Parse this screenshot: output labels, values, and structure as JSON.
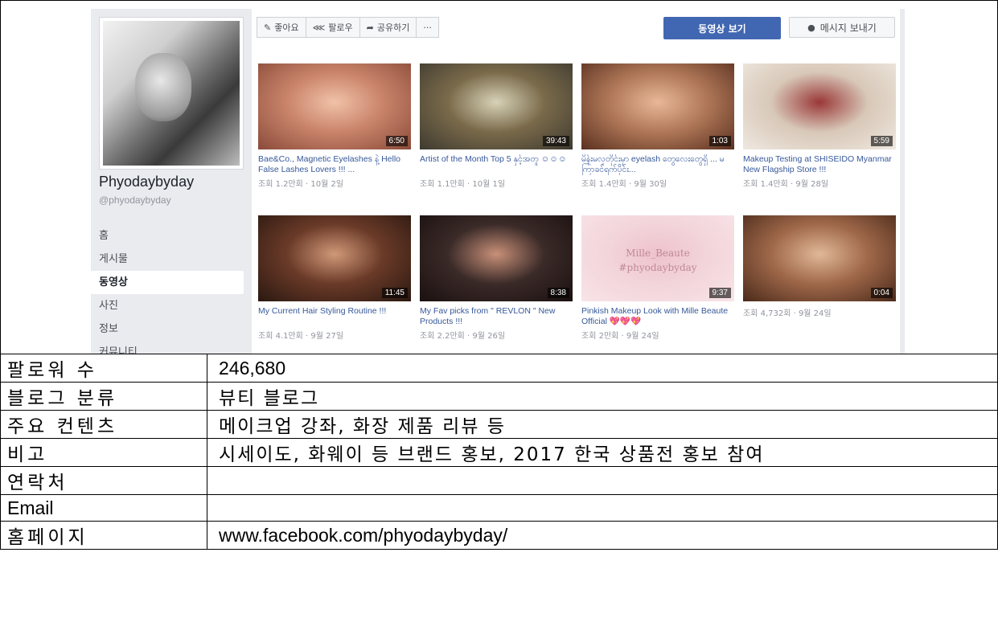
{
  "page": {
    "name": "Phyodaybyday",
    "handle": "@phyodaybyday"
  },
  "nav": [
    "홈",
    "게시물",
    "동영상",
    "사진",
    "정보",
    "커뮤니티"
  ],
  "nav_active_index": 2,
  "toolbar": {
    "like": "좋아요",
    "follow": "팔로우",
    "share": "공유하기",
    "more": "···",
    "watch": "동영상 보기",
    "message": "메시지 보내기"
  },
  "videos": [
    {
      "title": "Bae&Co., Magnetic Eyelashes နဲ့ Hello False Lashes Lovers !!! ...",
      "meta": "조회 1.2만회 · 10월 2일",
      "duration": "6:50",
      "colors": [
        "#c9836a",
        "#f0c2a8",
        "#8a4b3a"
      ]
    },
    {
      "title": "Artist of the Month Top 5 နှင့်အတူ ☺☺☺",
      "meta": "조회 1.1만회 · 10월 1일",
      "duration": "39:43",
      "colors": [
        "#7a6a4a",
        "#d8d2b8",
        "#3e3a30"
      ]
    },
    {
      "title": "မိန်းမလှတိုင်းမှာ eyelash တွေလေးတွေရှိ ... မကြာခင်ရက်ပိုင်း...",
      "meta": "조회 1.4만회 · 9월 30일",
      "duration": "1:03",
      "colors": [
        "#b07858",
        "#e8b898",
        "#5a3020"
      ]
    },
    {
      "title": "Makeup Testing at SHISEIDO Myanmar New Flagship Store !!!",
      "meta": "조회 1.4만회 · 9월 28일",
      "duration": "5:59",
      "colors": [
        "#d8c8b8",
        "#9a3838",
        "#efe8e0"
      ]
    },
    {
      "title": "My Current Hair Styling Routine !!!",
      "meta": "조회 4.1만회 · 9월 27일",
      "duration": "11:45",
      "colors": [
        "#6a3a28",
        "#d09878",
        "#2a1810"
      ]
    },
    {
      "title": "My Fav picks from \" REVLON \" New Products !!!",
      "meta": "조회 2.2만회 · 9월 26일",
      "duration": "8:38",
      "colors": [
        "#3a2a28",
        "#c89078",
        "#1a1010"
      ]
    },
    {
      "title": "Pinkish Makeup Look with Mille Beaute Official 💖💖💖",
      "meta": "조회 2만회 · 9월 24일",
      "duration": "9:37",
      "colors": [
        "#f2d4da",
        "#eec2cc",
        "#f8e4e8"
      ],
      "overlay": "Mille_Beaute\n#phyodaybyday"
    },
    {
      "title": "",
      "meta": "조회 4,732회 · 9월 24일",
      "duration": "0:04",
      "colors": [
        "#a0684a",
        "#e0b898",
        "#4a2a1a"
      ]
    }
  ],
  "info_table": [
    {
      "label": "팔로워 수",
      "value": "246,680",
      "latin": true
    },
    {
      "label": "블로그 분류",
      "value": "뷰티 블로그",
      "latin": false
    },
    {
      "label": "주요 컨텐츠",
      "value": "메이크업 강좌, 화장 제품 리뷰 등",
      "latin": false
    },
    {
      "label": "비고",
      "value": "시세이도, 화웨이 등 브랜드 홍보, 2017 한국 상품전 홍보 참여",
      "latin": false
    },
    {
      "label": "연락처",
      "value": "",
      "latin": false
    },
    {
      "label": "Email",
      "value": "",
      "latin": false,
      "label_latin": true
    },
    {
      "label": "홈페이지",
      "value": "www.facebook.com/phyodaybyday/",
      "latin": true
    }
  ],
  "colors": {
    "fb_blue": "#4267b2",
    "link": "#365899",
    "meta": "#90949c",
    "sidebar_bg": "#e9ebee"
  }
}
